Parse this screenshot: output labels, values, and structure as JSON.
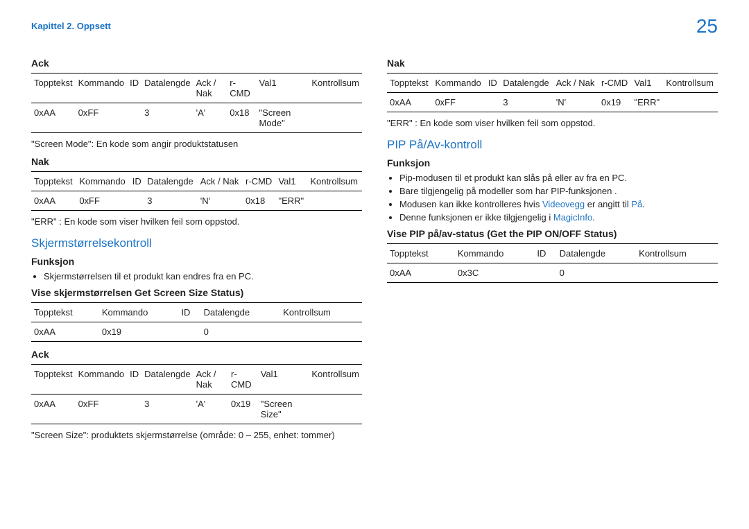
{
  "chapter": "Kapittel 2. Oppsett",
  "page_number": "25",
  "left": {
    "ack_heading": "Ack",
    "ack_table": {
      "headers": [
        "Topptekst",
        "Kommando",
        "ID",
        "Datalengde",
        "Ack / Nak",
        "r-CMD",
        "Val1",
        "Kontrollsum"
      ],
      "row": [
        "0xAA",
        "0xFF",
        "",
        "3",
        "'A'",
        "0x18",
        "\"Screen Mode\"",
        ""
      ]
    },
    "ack_note": "\"Screen Mode\": En kode som angir produktstatusen",
    "nak_heading": "Nak",
    "nak_table": {
      "headers": [
        "Topptekst",
        "Kommando",
        "ID",
        "Datalengde",
        "Ack / Nak",
        "r-CMD",
        "Val1",
        "Kontrollsum"
      ],
      "row": [
        "0xAA",
        "0xFF",
        "",
        "3",
        "'N'",
        "0x18",
        "\"ERR\"",
        ""
      ]
    },
    "nak_note": "\"ERR\" : En kode som viser hvilken feil som oppstod.",
    "skjerm_heading": "Skjermstørrelsekontroll",
    "funksjon_heading": "Funksjon",
    "funksjon_bullet": "Skjermstørrelsen til et produkt kan endres fra en PC.",
    "vise_heading": "Vise skjermstørrelsen Get Screen Size Status)",
    "vise_table": {
      "headers": [
        "Topptekst",
        "Kommando",
        "ID",
        "Datalengde",
        "Kontrollsum"
      ],
      "row": [
        "0xAA",
        "0x19",
        "",
        "0",
        ""
      ]
    },
    "ack2_heading": "Ack",
    "ack2_table": {
      "headers": [
        "Topptekst",
        "Kommando",
        "ID",
        "Datalengde",
        "Ack / Nak",
        "r-CMD",
        "Val1",
        "Kontrollsum"
      ],
      "row": [
        "0xAA",
        "0xFF",
        "",
        "3",
        "'A'",
        "0x19",
        "\"Screen Size\"",
        ""
      ]
    },
    "ack2_note": "\"Screen Size\": produktets skjermstørrelse (område: 0 – 255, enhet: tommer)"
  },
  "right": {
    "nak_heading": "Nak",
    "nak_table": {
      "headers": [
        "Topptekst",
        "Kommando",
        "ID",
        "Datalengde",
        "Ack / Nak",
        "r-CMD",
        "Val1",
        "Kontrollsum"
      ],
      "row": [
        "0xAA",
        "0xFF",
        "",
        "3",
        "'N'",
        "0x19",
        "\"ERR\"",
        ""
      ]
    },
    "nak_note": "\"ERR\" : En kode som viser hvilken feil som oppstod.",
    "pip_heading": "PIP På/Av-kontroll",
    "funksjon_heading": "Funksjon",
    "bullet1": "Pip-modusen til et produkt kan slås på eller av fra en PC.",
    "bullet2": "Bare tilgjengelig på modeller som har PIP-funksjonen .",
    "bullet3a": "Modusen kan ikke kontrolleres hvis ",
    "bullet3_link": "Videovegg",
    "bullet3b": " er angitt til ",
    "bullet3_link2": "På",
    "bullet3c": ".",
    "bullet4a": "Denne funksjonen er ikke tilgjengelig i ",
    "bullet4_link": "MagicInfo",
    "bullet4b": ".",
    "vise_heading": "Vise PIP på/av-status (Get the PIP ON/OFF Status)",
    "vise_table": {
      "headers": [
        "Topptekst",
        "Kommando",
        "ID",
        "Datalengde",
        "Kontrollsum"
      ],
      "row": [
        "0xAA",
        "0x3C",
        "",
        "0",
        ""
      ]
    }
  }
}
